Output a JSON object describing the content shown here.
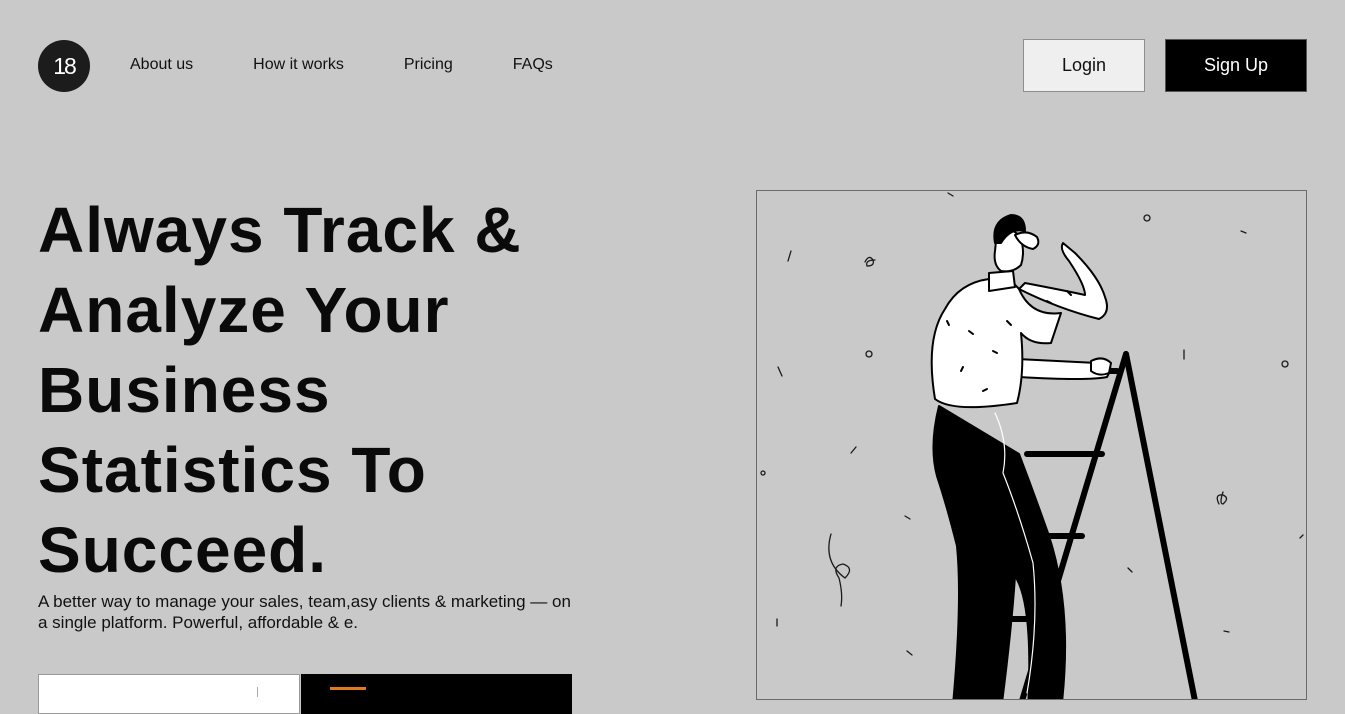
{
  "header": {
    "logo_text": "18",
    "nav": [
      {
        "label": "About us"
      },
      {
        "label": "How it works"
      },
      {
        "label": "Pricing"
      },
      {
        "label": "FAQs"
      }
    ],
    "login_label": "Login",
    "signup_label": "Sign Up"
  },
  "hero": {
    "title": "Always Track & Analyze Your Business Statistics To Succeed.",
    "subtitle": "A better way to manage your sales, team,asy clients & marketing — on a single platform. Powerful, affordable & e.",
    "email_placeholder": "",
    "cta_label": ""
  },
  "illustration": {
    "icon": "person-on-ladder-illustration"
  },
  "colors": {
    "background": "#c9c9c9",
    "primary": "#000000",
    "login_bg": "#efefef",
    "accent": "#e07a1f"
  }
}
